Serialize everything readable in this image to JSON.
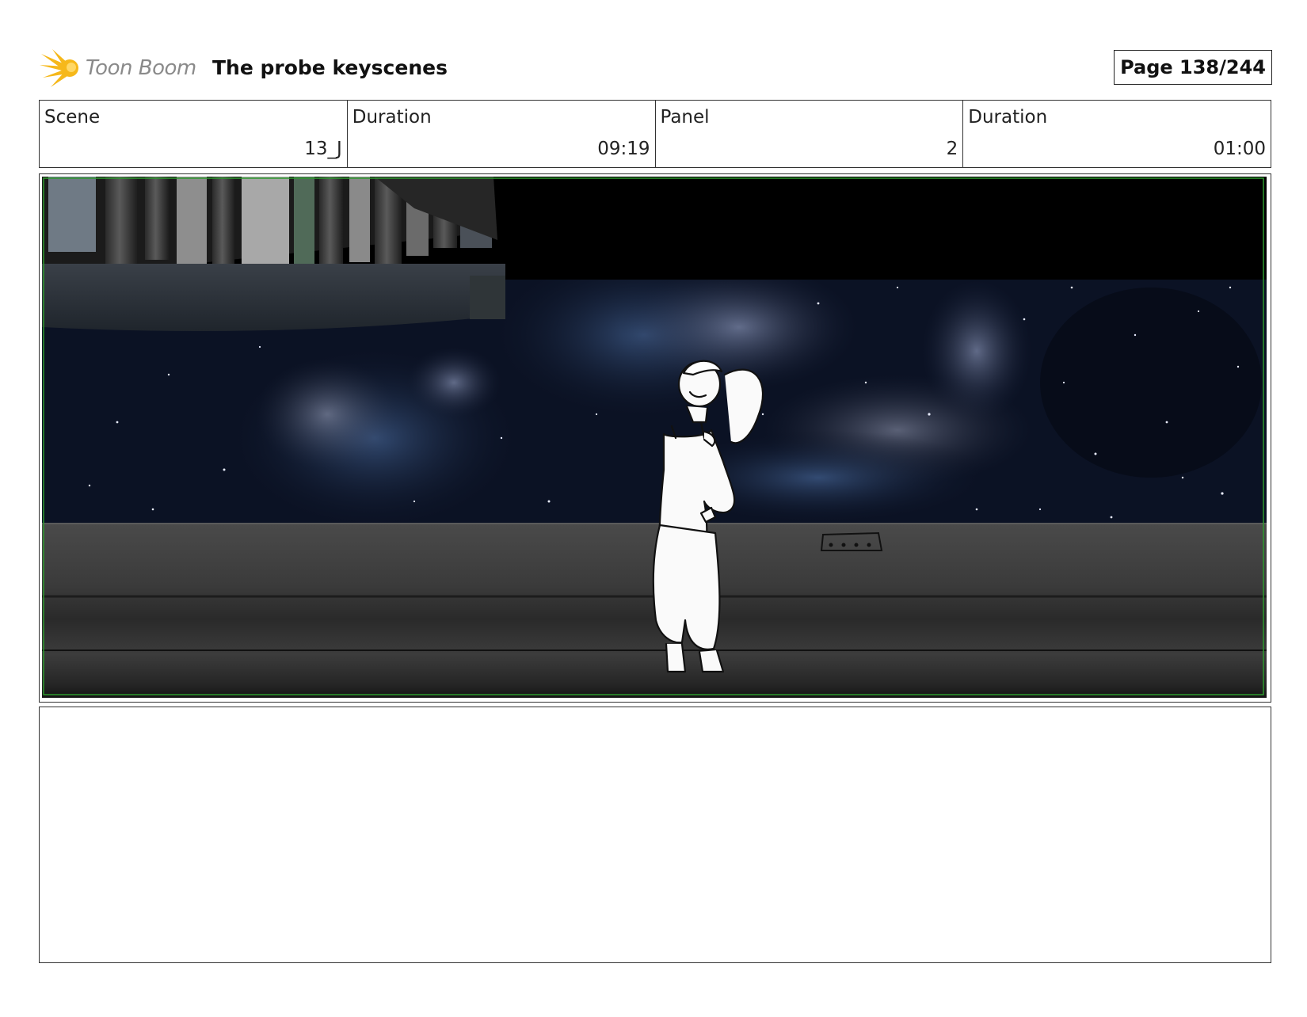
{
  "header": {
    "logo_text": "Toon Boom",
    "title": "The probe keyscenes",
    "page": "Page 138/244"
  },
  "info": {
    "scene_label": "Scene",
    "scene_value": "13_J",
    "scene_duration_label": "Duration",
    "scene_duration_value": "09:19",
    "panel_label": "Panel",
    "panel_value": "2",
    "panel_duration_label": "Duration",
    "panel_duration_value": "01:00"
  },
  "colors": {
    "logo_yellow": "#f6b81a",
    "safe_frame": "#2e9a2e",
    "space_deep": "#05070f",
    "floor_gray": "#3e3e3e"
  },
  "notes": {
    "text": ""
  }
}
